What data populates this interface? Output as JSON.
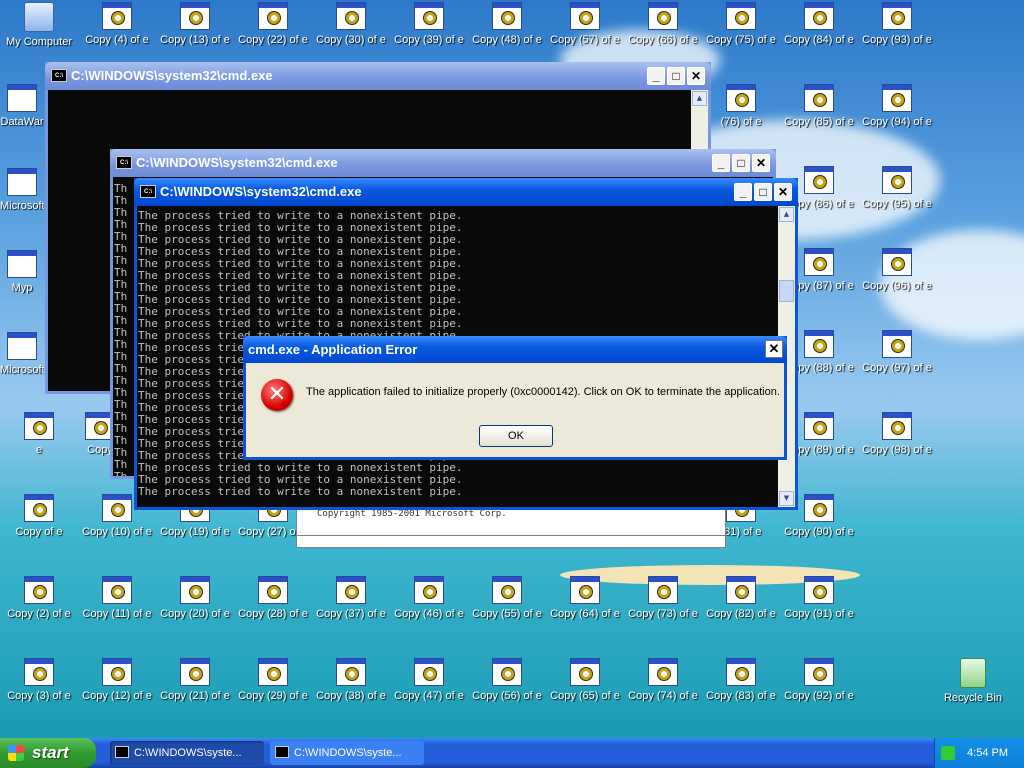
{
  "desktop": {
    "my_computer": "My Computer",
    "datawar": "DataWar",
    "microsoft_cpp": "Microsoft C++",
    "myp": "Myp",
    "microsoft_basic": "Microsoft Basic",
    "e": "e",
    "copy_prefix": "Copy",
    "copy_of_e": "Copy of e",
    "recycle_bin": "Recycle Bin",
    "icons_row0": [
      "Copy (4) of e",
      "Copy (13) of e",
      "Copy (22) of e",
      "Copy (30) of e",
      "Copy (39) of e",
      "Copy (48) of e",
      "Copy (57) of e",
      "Copy (66) of e",
      "Copy (75) of e",
      "Copy (84) of e",
      "Copy (93) of e"
    ],
    "icons_row1": [
      "(76) of e",
      "Copy (85) of e",
      "Copy (94) of e"
    ],
    "icons_row2": [
      "Copy (86) of e",
      "Copy (95) of e"
    ],
    "icons_row3": [
      "Copy (87) of e",
      "Copy (96) of e"
    ],
    "icons_row4": [
      "Copy (88) of e",
      "Copy (97) of e"
    ],
    "icons_row5": [
      "Copy (89) of e",
      "Copy (98) of e"
    ],
    "icons_row6": [
      "Copy of e",
      "Copy (10) of e",
      "Copy (19) of e",
      "Copy (27) of e",
      "(81) of e",
      "Copy (90) of e"
    ],
    "icons_row7": [
      "Copy (2) of e",
      "Copy (11) of e",
      "Copy (20) of e",
      "Copy (28) of e",
      "Copy (37) of e",
      "Copy (46) of e",
      "Copy (55) of e",
      "Copy (64) of e",
      "Copy (73) of e",
      "Copy (82) of e",
      "Copy (91) of e"
    ],
    "icons_row8": [
      "Copy (3) of e",
      "Copy (12) of e",
      "Copy (21) of e",
      "Copy (29) of e",
      "Copy (38) of e",
      "Copy (47) of e",
      "Copy (56) of e",
      "Copy (65) of e",
      "Copy (74) of e",
      "Copy (83) of e",
      "Copy (92) of e"
    ]
  },
  "windows": {
    "cmd_title": "C:\\WINDOWS\\system32\\cmd.exe",
    "line_fragment": "Th",
    "console_line": "The process tried to write to a nonexistent pipe.",
    "process_fragment": "The process t",
    "behind_text": "Copyright 1985-2001 Microsoft Corp."
  },
  "dialog": {
    "title": "cmd.exe - Application Error",
    "message": "The application failed to initialize properly (0xc0000142). Click on OK to terminate the application.",
    "ok_label": "OK",
    "close_glyph": "✕"
  },
  "taskbar": {
    "start_label": "start",
    "task1": "C:\\WINDOWS\\syste...",
    "task2": "C:\\WINDOWS\\syste...",
    "clock": "4:54 PM"
  },
  "colors": {
    "title_active": "#0a56d6",
    "title_inactive": "#7a96df",
    "taskbar": "#245edb",
    "start_green": "#2f9a2f",
    "error_red": "#d60000"
  }
}
